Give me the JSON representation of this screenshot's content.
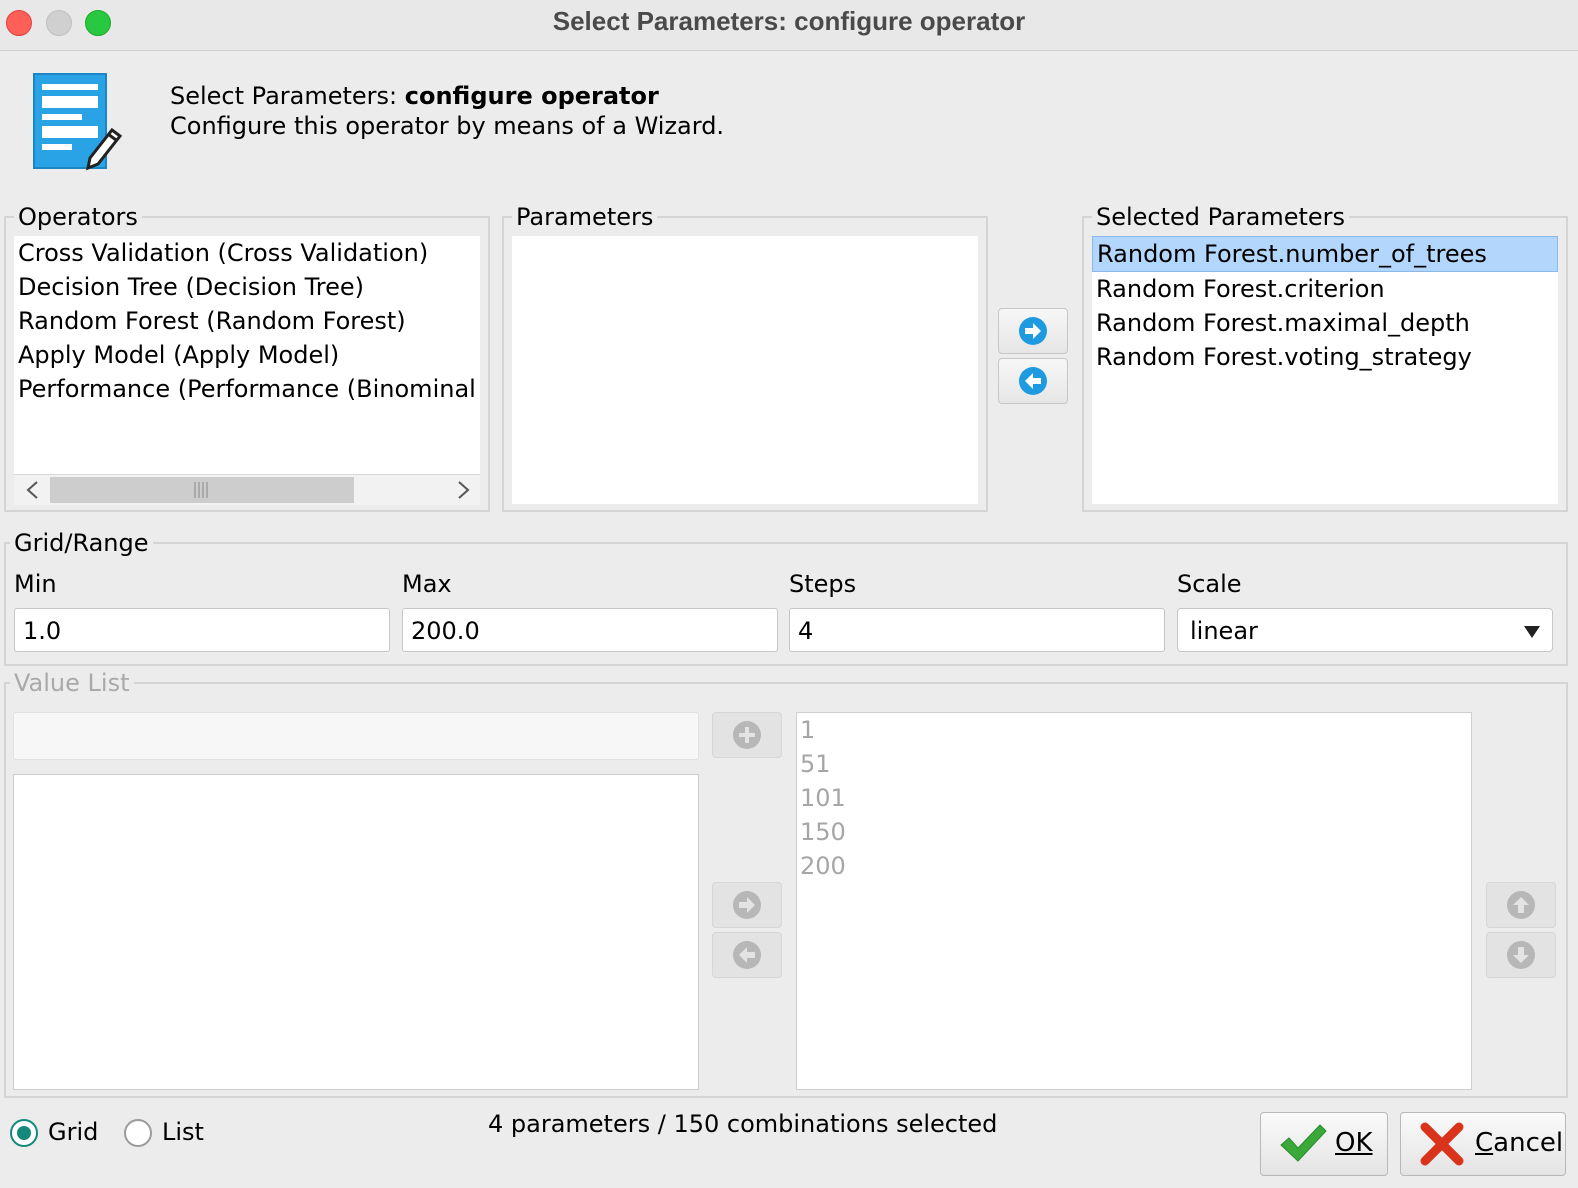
{
  "window": {
    "title": "Select Parameters: configure operator"
  },
  "header": {
    "title_prefix": "Select Parameters: ",
    "title_bold": "configure operator",
    "subtitle": "Configure this operator by means of a Wizard."
  },
  "operators": {
    "legend": "Operators",
    "items": [
      "Cross Validation (Cross Validation)",
      "Decision Tree (Decision Tree)",
      "Random Forest (Random Forest)",
      "Apply Model (Apply Model)",
      "Performance (Performance (Binominal Cl"
    ]
  },
  "parameters": {
    "legend": "Parameters",
    "items": []
  },
  "selected_parameters": {
    "legend": "Selected Parameters",
    "items": [
      "Random Forest.number_of_trees",
      "Random Forest.criterion",
      "Random Forest.maximal_depth",
      "Random Forest.voting_strategy"
    ],
    "selected_index": 0
  },
  "grid_range": {
    "legend": "Grid/Range",
    "min_label": "Min",
    "min_value": "1.0",
    "max_label": "Max",
    "max_value": "200.0",
    "steps_label": "Steps",
    "steps_value": "4",
    "scale_label": "Scale",
    "scale_value": "linear"
  },
  "value_list": {
    "legend": "Value List",
    "input_value": "",
    "values": [
      "1",
      "51",
      "101",
      "150",
      "200"
    ]
  },
  "footer": {
    "radio_grid": "Grid",
    "radio_list": "List",
    "selected_mode": "Grid",
    "status": "4 parameters / 150 combinations selected",
    "ok_label": "OK",
    "cancel_label": "Cancel"
  },
  "colors": {
    "accent_blue": "#1e9be0",
    "selection": "#b3d6fc",
    "ok_green": "#3aa93a",
    "cancel_red": "#d9341b",
    "radio_selected": "#12897a"
  }
}
